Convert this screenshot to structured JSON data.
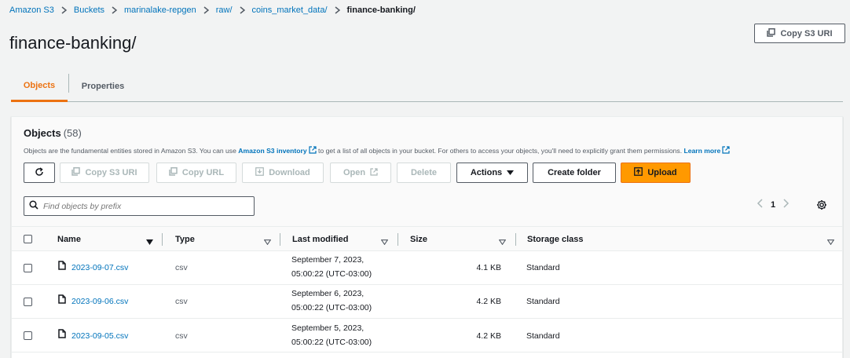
{
  "breadcrumb": {
    "items": [
      "Amazon S3",
      "Buckets",
      "marinalake-repgen",
      "raw/",
      "coins_market_data/"
    ],
    "current": "finance-banking/"
  },
  "page": {
    "title": "finance-banking/",
    "copy_uri_label": "Copy S3 URI"
  },
  "tabs": [
    {
      "label": "Objects",
      "active": true
    },
    {
      "label": "Properties",
      "active": false
    }
  ],
  "objects": {
    "title": "Objects",
    "count": "(58)",
    "description_pre": "Objects are the fundamental entities stored in Amazon S3. You can use",
    "inventory_link": "Amazon S3 inventory",
    "description_mid": "to get a list of all objects in your bucket. For others to access your objects, you'll need to explicitly grant them permissions.",
    "learn_more": "Learn more"
  },
  "toolbar": {
    "copy_s3_uri": "Copy S3 URI",
    "copy_url": "Copy URL",
    "download": "Download",
    "open": "Open",
    "delete": "Delete",
    "actions": "Actions",
    "create_folder": "Create folder",
    "upload": "Upload"
  },
  "search": {
    "placeholder": "Find objects by prefix",
    "value": ""
  },
  "pagination": {
    "current_page": "1"
  },
  "table": {
    "columns": [
      "Name",
      "Type",
      "Last modified",
      "Size",
      "Storage class"
    ],
    "rows": [
      {
        "name": "2023-09-07.csv",
        "type": "csv",
        "modified_line1": "September 7, 2023,",
        "modified_line2": "05:00:22 (UTC-03:00)",
        "size": "4.1 KB",
        "storage": "Standard"
      },
      {
        "name": "2023-09-06.csv",
        "type": "csv",
        "modified_line1": "September 6, 2023,",
        "modified_line2": "05:00:22 (UTC-03:00)",
        "size": "4.2 KB",
        "storage": "Standard"
      },
      {
        "name": "2023-09-05.csv",
        "type": "csv",
        "modified_line1": "September 5, 2023,",
        "modified_line2": "05:00:22 (UTC-03:00)",
        "size": "4.2 KB",
        "storage": "Standard"
      }
    ]
  },
  "colors": {
    "link": "#0073bb",
    "accent": "#ec7211",
    "upload_bg": "#ff9900"
  }
}
